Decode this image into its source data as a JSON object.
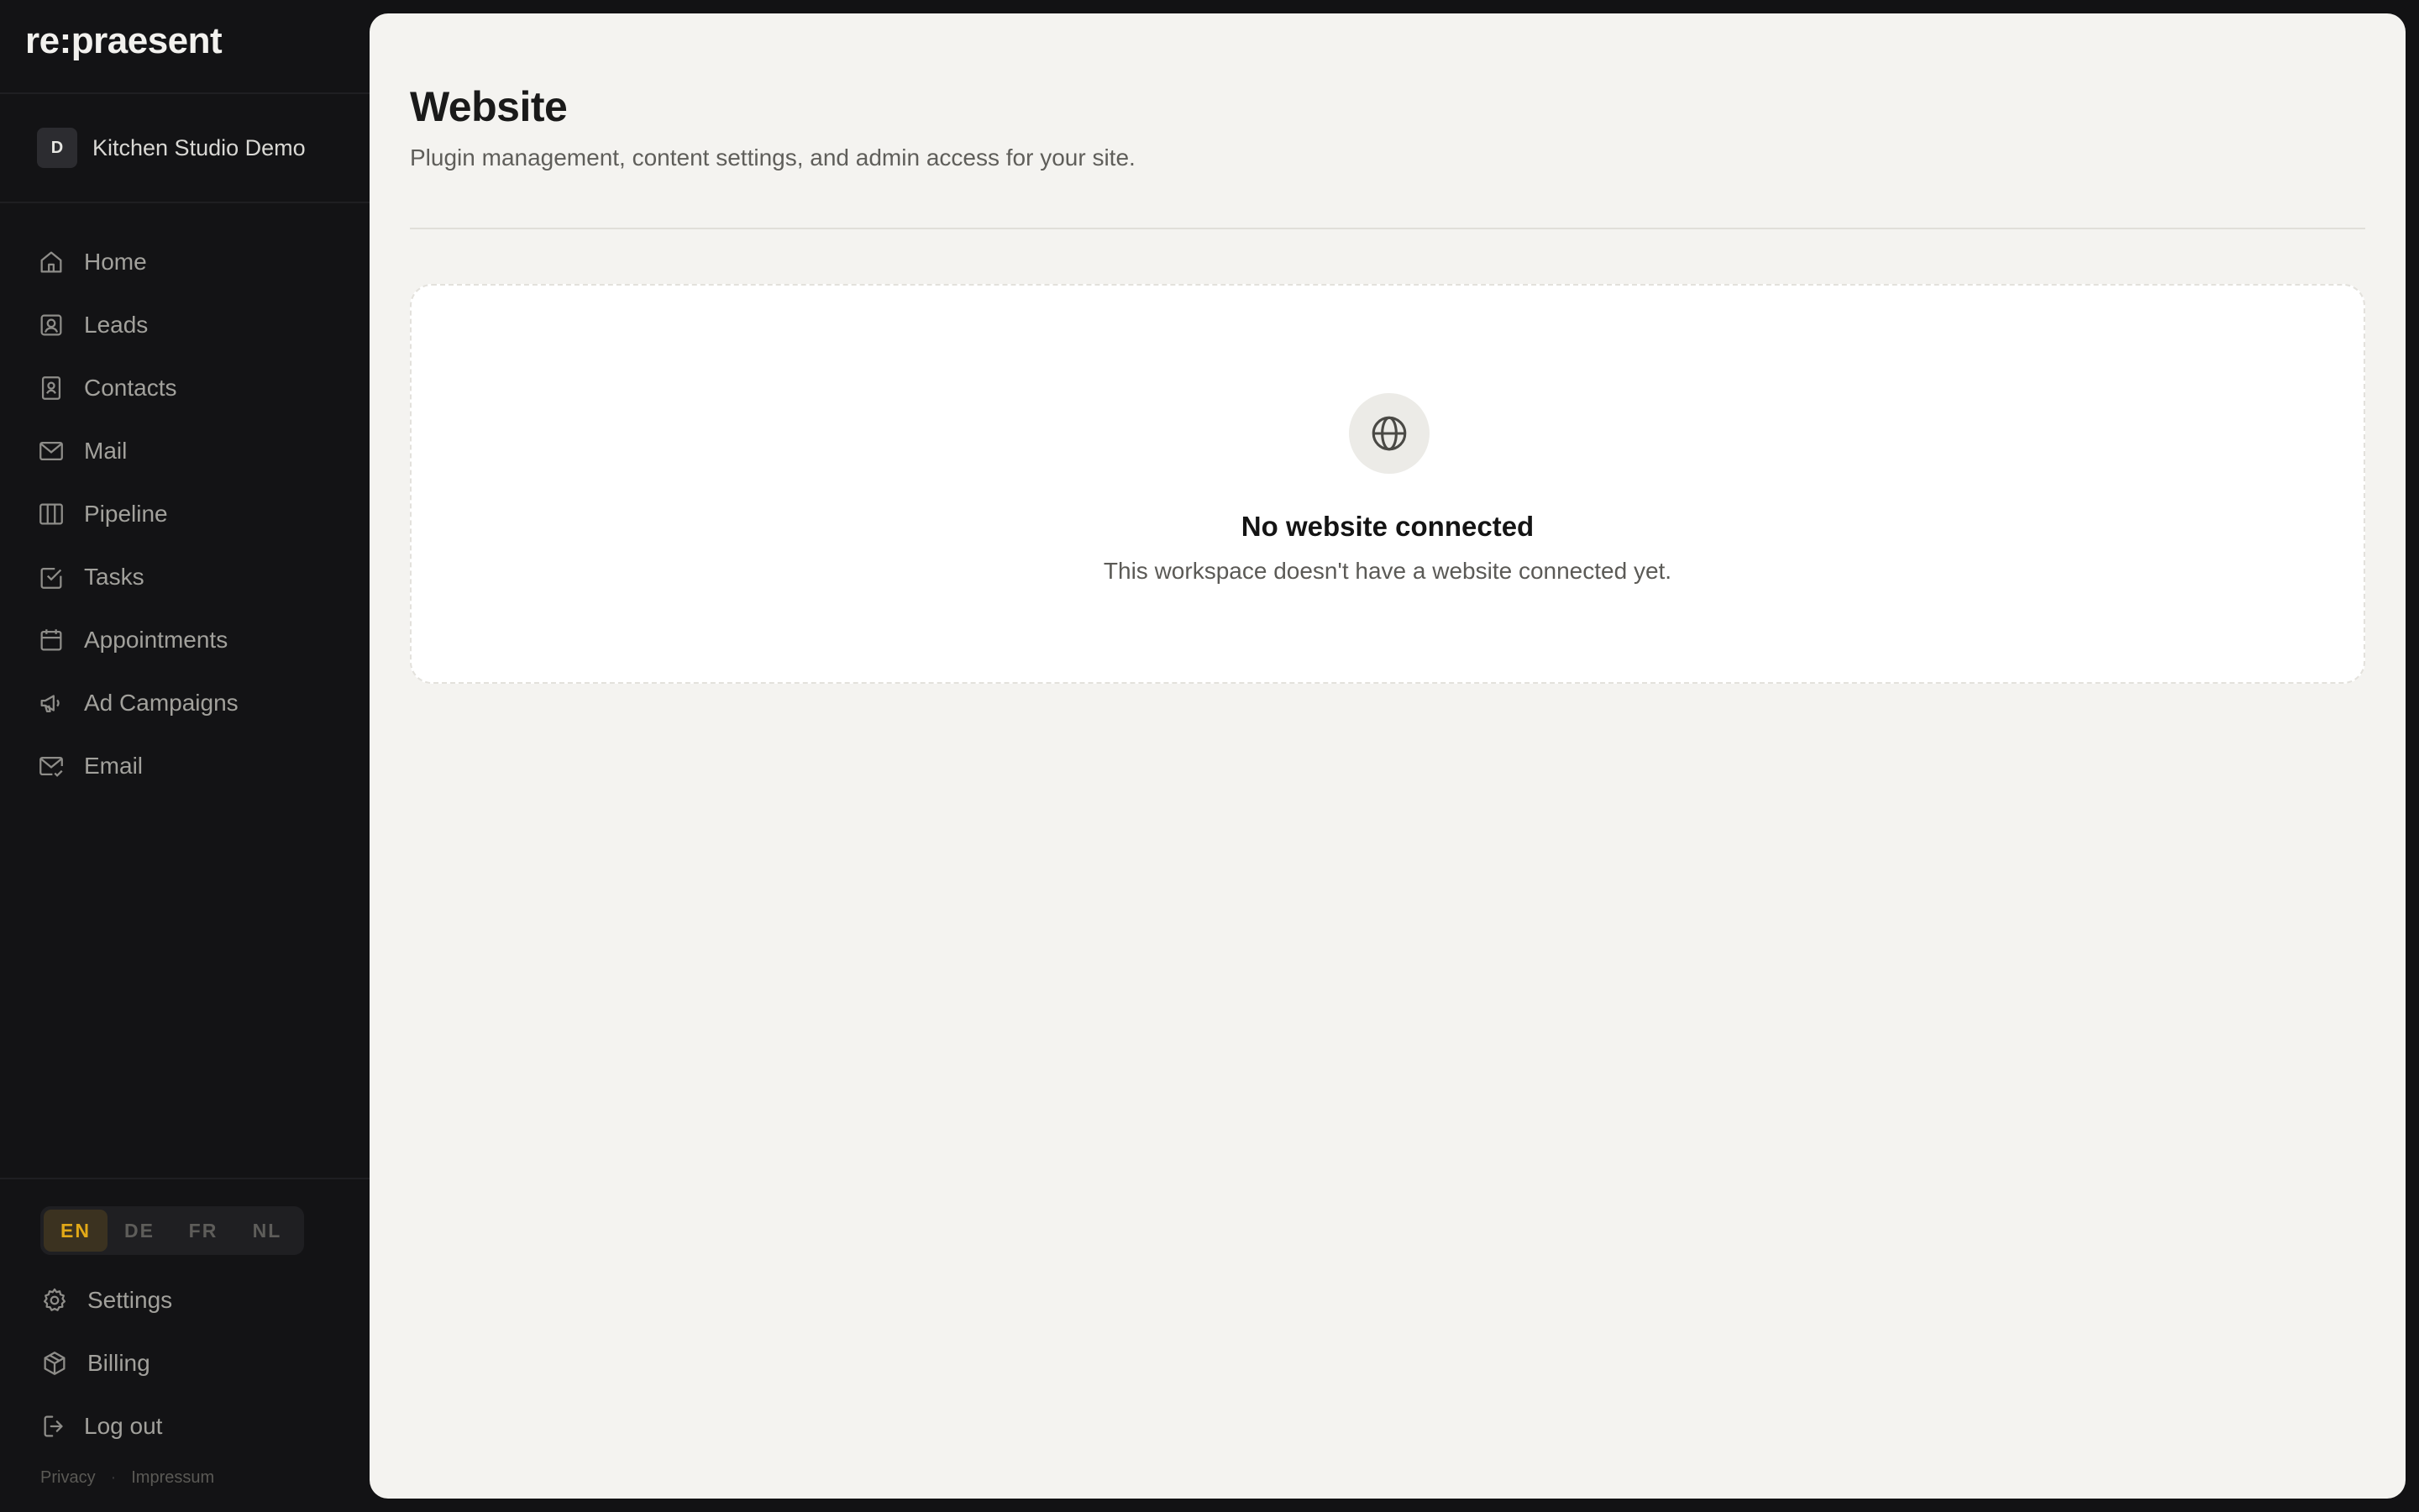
{
  "brand": {
    "logo_text": "re:praesent"
  },
  "workspace": {
    "avatar_letter": "D",
    "name": "Kitchen Studio Demo"
  },
  "sidebar": {
    "items": [
      {
        "label": "Home",
        "icon": "home-icon"
      },
      {
        "label": "Leads",
        "icon": "lead-contact-icon"
      },
      {
        "label": "Contacts",
        "icon": "contact-book-icon"
      },
      {
        "label": "Mail",
        "icon": "mail-icon"
      },
      {
        "label": "Pipeline",
        "icon": "columns-icon"
      },
      {
        "label": "Tasks",
        "icon": "checkbox-icon"
      },
      {
        "label": "Appointments",
        "icon": "calendar-icon"
      },
      {
        "label": "Ad Campaigns",
        "icon": "megaphone-icon"
      },
      {
        "label": "Email",
        "icon": "mail-check-icon"
      }
    ],
    "languages": [
      "EN",
      "DE",
      "FR",
      "NL"
    ],
    "active_language": "EN",
    "bottom_items": [
      {
        "label": "Settings",
        "icon": "gear-icon"
      },
      {
        "label": "Billing",
        "icon": "package-icon"
      },
      {
        "label": "Log out",
        "icon": "logout-icon"
      }
    ],
    "footer_links": [
      "Privacy",
      "Impressum"
    ]
  },
  "main": {
    "title": "Website",
    "subtitle": "Plugin management, content settings, and admin access for your site.",
    "empty_state": {
      "icon": "globe-icon",
      "title": "No website connected",
      "text": "This workspace doesn't have a website connected yet."
    }
  },
  "colors": {
    "sidebar_bg": "#131315",
    "main_bg": "#f4f3f0",
    "accent": "#e2a917"
  }
}
